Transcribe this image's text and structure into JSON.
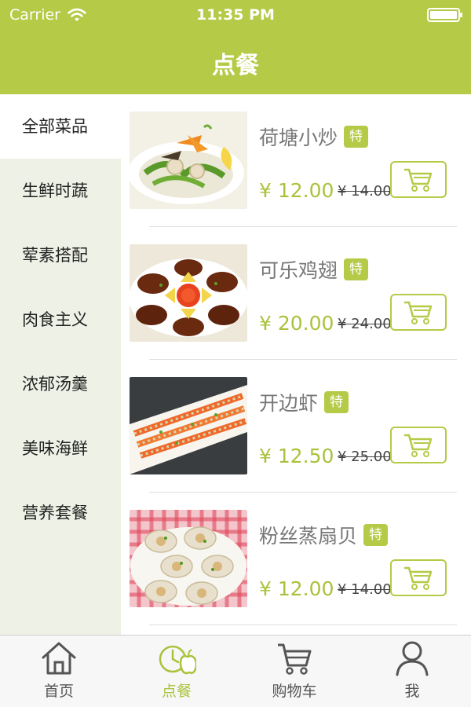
{
  "status_bar": {
    "carrier": "Carrier",
    "time": "11:35 PM"
  },
  "header": {
    "title": "点餐"
  },
  "colors": {
    "accent": "#b5ca46",
    "price": "#a9c23c",
    "sidebar_bg": "#eef1e6"
  },
  "sidebar": {
    "items": [
      {
        "label": "全部菜品",
        "active": true
      },
      {
        "label": "生鲜时蔬",
        "active": false
      },
      {
        "label": "荤素搭配",
        "active": false
      },
      {
        "label": "肉食主义",
        "active": false
      },
      {
        "label": "浓郁汤羹",
        "active": false
      },
      {
        "label": "美味海鲜",
        "active": false
      },
      {
        "label": "营养套餐",
        "active": false
      }
    ]
  },
  "products": [
    {
      "name": "荷塘小炒",
      "badge": "特",
      "price": "¥ 12.00",
      "old_price": "¥ 14.00",
      "image": "lotus-stir-fry-photo"
    },
    {
      "name": "可乐鸡翅",
      "badge": "特",
      "price": "¥ 20.00",
      "old_price": "¥ 24.00",
      "image": "cola-chicken-wings-photo"
    },
    {
      "name": "开边虾",
      "badge": "特",
      "price": "¥ 12.50",
      "old_price": "¥ 25.00",
      "image": "butterflied-shrimp-photo"
    },
    {
      "name": "粉丝蒸扇贝",
      "badge": "特",
      "price": "¥ 12.00",
      "old_price": "¥ 14.00",
      "image": "steamed-scallop-vermicelli-photo"
    }
  ],
  "tabbar": {
    "tabs": [
      {
        "label": "首页",
        "icon": "home-icon",
        "active": false
      },
      {
        "label": "点餐",
        "icon": "clock-apple-icon",
        "active": true
      },
      {
        "label": "购物车",
        "icon": "cart-icon",
        "active": false
      },
      {
        "label": "我",
        "icon": "user-icon",
        "active": false
      }
    ]
  }
}
